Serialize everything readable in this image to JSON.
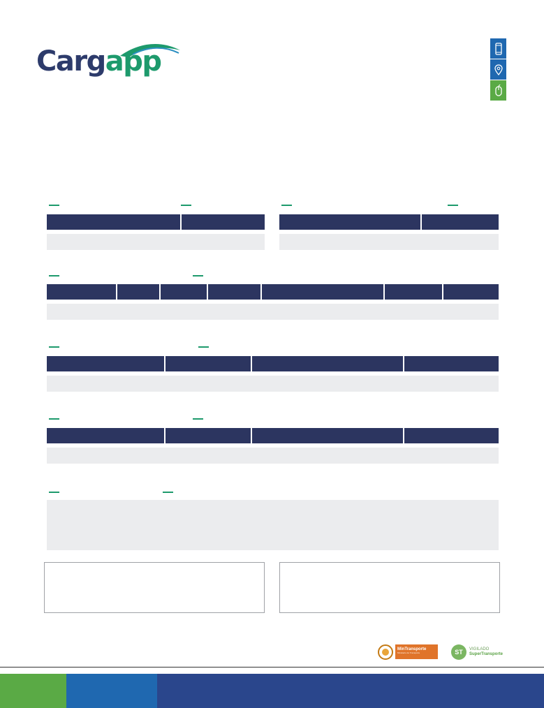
{
  "brand": {
    "logo_part1": "Carg",
    "logo_part2": "app",
    "primary_color": "#2d3b6b",
    "accent_color": "#1d9a6c"
  },
  "side_icons": [
    {
      "name": "mobile-phone-icon",
      "color": "#1f68b0"
    },
    {
      "name": "location-pin-icon",
      "color": "#1f68b0"
    },
    {
      "name": "mouse-icon",
      "color": "#5aaa45"
    }
  ],
  "footer": {
    "logo_mintransporte": "MinTransporte",
    "logo_mintransporte_sub": "Ministerio de Transporte",
    "logo_vigilado": "VIGILADO",
    "logo_supertransporte": "SuperTransporte",
    "bar_colors": [
      "#5aaa45",
      "#1f68b0",
      "#2a468c"
    ]
  },
  "colors": {
    "header_fill": "#2c3560",
    "row_fill": "#ebecee",
    "border": "#9fa1a6"
  }
}
